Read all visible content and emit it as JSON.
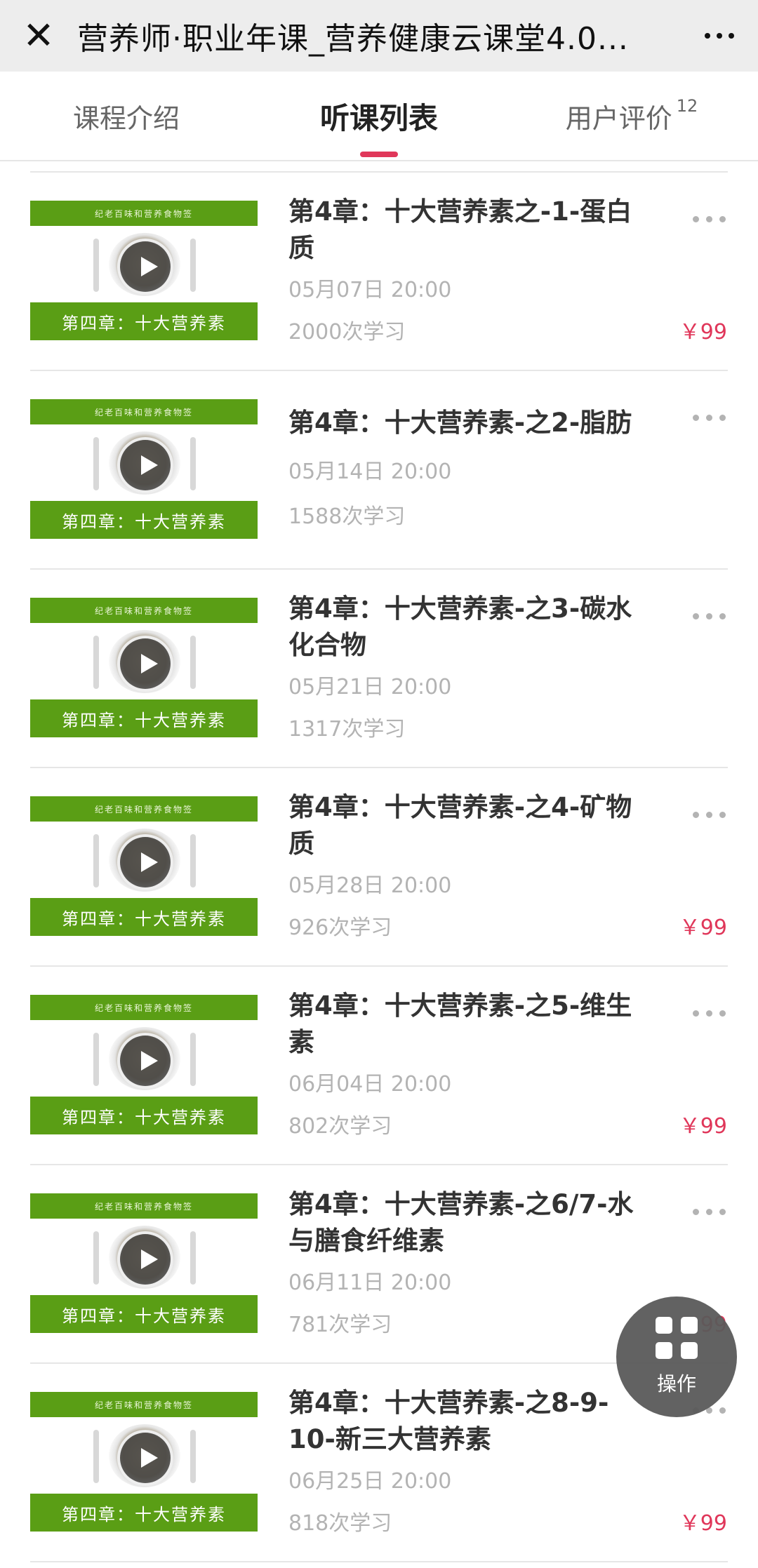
{
  "topbar": {
    "close_icon": "close-icon",
    "title": "营养师·职业年课_营养健康云课堂4.0...",
    "more_icon": "more-icon"
  },
  "tabs": [
    {
      "label": "课程介绍",
      "active": false
    },
    {
      "label": "听课列表",
      "active": true
    },
    {
      "label": "用户评价",
      "badge": "12",
      "active": false
    }
  ],
  "thumbnail": {
    "header": "纪老百味和营养食物签",
    "chapter": "第四章：十大营养素"
  },
  "lessons": [
    {
      "title": "第4章：十大营养素之-1-蛋白质",
      "date": "05月07日 20:00",
      "count": "2000次学习",
      "price": "￥99"
    },
    {
      "title": "第4章：十大营养素-之2-脂肪",
      "date": "05月14日 20:00",
      "count": "1588次学习",
      "price": ""
    },
    {
      "title": "第4章：十大营养素-之3-碳水化合物",
      "date": "05月21日 20:00",
      "count": "1317次学习",
      "price": ""
    },
    {
      "title": "第4章：十大营养素-之4-矿物质",
      "date": "05月28日 20:00",
      "count": "926次学习",
      "price": "￥99"
    },
    {
      "title": "第4章：十大营养素-之5-维生素",
      "date": "06月04日 20:00",
      "count": "802次学习",
      "price": "￥99"
    },
    {
      "title": "第4章：十大营养素-之6/7-水与膳食纤维素",
      "date": "06月11日 20:00",
      "count": "781次学习",
      "price": "￥99"
    },
    {
      "title": "第4章：十大营养素-之8-9-10-新三大营养素",
      "date": "06月25日 20:00",
      "count": "818次学习",
      "price": "￥99"
    }
  ],
  "fab": {
    "label": "操作",
    "icon": "grid-icon"
  },
  "colors": {
    "accent": "#e0375a",
    "thumb_green": "#5a9e15",
    "muted": "#b3b3b3"
  }
}
